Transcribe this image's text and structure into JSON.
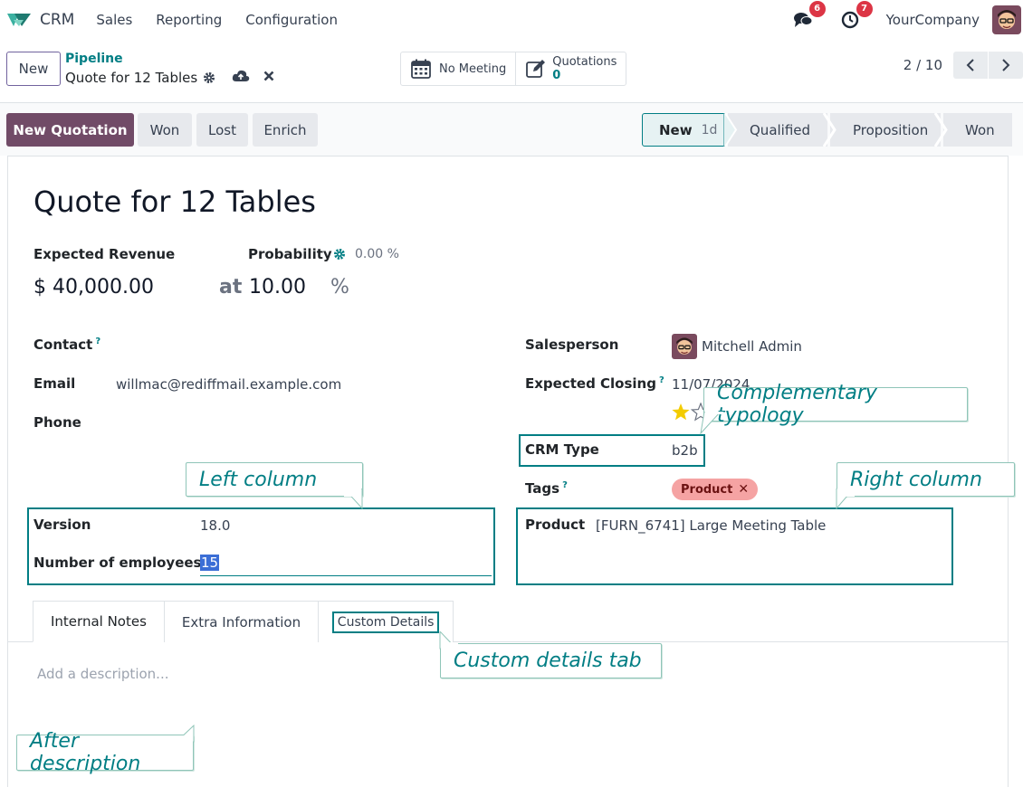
{
  "navbar": {
    "app_name": "CRM",
    "menu": [
      "Sales",
      "Reporting",
      "Configuration"
    ],
    "messages_count": "6",
    "activities_count": "7",
    "company": "YourCompany"
  },
  "control": {
    "new_label": "New",
    "breadcrumb": "Pipeline",
    "record_name": "Quote for 12 Tables",
    "meeting_label": "No Meeting",
    "quotations_label": "Quotations",
    "quotations_count": "0",
    "pager": "2 / 10"
  },
  "actions": {
    "new_quotation": "New Quotation",
    "won": "Won",
    "lost": "Lost",
    "enrich": "Enrich"
  },
  "stages": [
    {
      "name": "New",
      "duration": "1d"
    },
    {
      "name": "Qualified"
    },
    {
      "name": "Proposition"
    },
    {
      "name": "Won"
    }
  ],
  "form": {
    "title": "Quote for 12 Tables",
    "expected_revenue_label": "Expected Revenue",
    "expected_revenue": "$ 40,000.00",
    "at": "at",
    "probability_label": "Probability",
    "probability_auto": "0.00 %",
    "probability": "10.00",
    "percent": "%",
    "contact_label": "Contact",
    "email_label": "Email",
    "email": "willmac@rediffmail.example.com",
    "phone_label": "Phone",
    "salesperson_label": "Salesperson",
    "salesperson": "Mitchell Admin",
    "expected_closing_label": "Expected Closing",
    "expected_closing": "11/07/2024",
    "crm_type_label": "CRM Type",
    "crm_type": "b2b",
    "tags_label": "Tags",
    "tag": "Product",
    "version_label": "Version",
    "version": "18.0",
    "employees_label": "Number of employees",
    "employees": "15",
    "product_label": "Product",
    "product": "[FURN_6741] Large Meeting Table",
    "help_mark": "?"
  },
  "tabs": [
    "Internal Notes",
    "Extra Information",
    "Custom Details"
  ],
  "description_placeholder": "Add a description...",
  "callouts": {
    "complementary": "Complementary typology",
    "left_column": "Left column",
    "right_column": "Right column",
    "custom_tab": "Custom details tab",
    "after_description": "After description"
  },
  "colors": {
    "primary": "#714b67",
    "accent": "#017e84",
    "badge": "#dc3545",
    "tag": "#f5a3a3"
  }
}
